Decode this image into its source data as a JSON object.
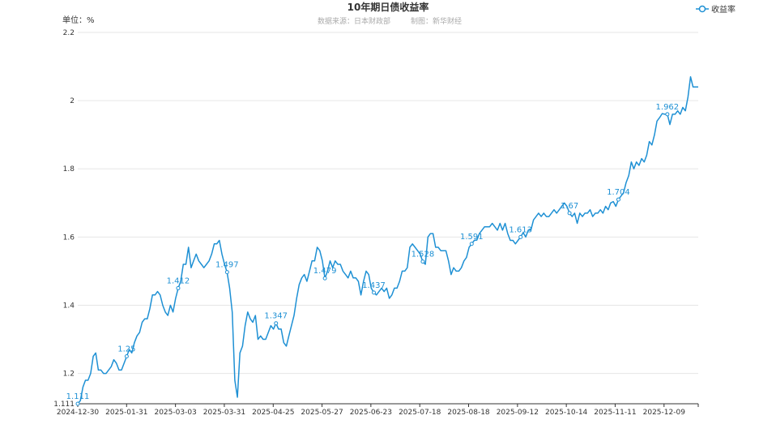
{
  "chart_data": {
    "type": "line",
    "title": "10年期日债收益率",
    "source": "数据来源：日本财政部",
    "maker": "制图：新华财经",
    "unit_label": "单位：%",
    "ylim": [
      1.111,
      2.2
    ],
    "y_ticks": [
      "2.2",
      "2",
      "1.8",
      "1.6",
      "1.4",
      "1.2",
      "1.111"
    ],
    "y_tick_values": [
      2.2,
      2.0,
      1.8,
      1.6,
      1.4,
      1.2,
      1.111
    ],
    "x_ticks": [
      "2024-12-30",
      "2025-01-31",
      "2025-03-03",
      "2025-03-31",
      "2025-04-25",
      "2025-05-27",
      "2025-06-23",
      "2025-07-18",
      "2025-08-18",
      "2025-09-12",
      "2025-10-14",
      "2025-11-11",
      "2025-12-09"
    ],
    "grid": true,
    "legend_position": "top-right",
    "series": [
      {
        "name": "收益率",
        "color": "#1e90d4",
        "values": [
          1.111,
          1.12,
          1.16,
          1.18,
          1.18,
          1.2,
          1.25,
          1.26,
          1.21,
          1.21,
          1.2,
          1.2,
          1.21,
          1.22,
          1.24,
          1.23,
          1.21,
          1.21,
          1.23,
          1.25,
          1.27,
          1.26,
          1.29,
          1.31,
          1.32,
          1.35,
          1.36,
          1.36,
          1.39,
          1.43,
          1.43,
          1.44,
          1.43,
          1.4,
          1.38,
          1.37,
          1.4,
          1.38,
          1.42,
          1.45,
          1.47,
          1.52,
          1.52,
          1.57,
          1.51,
          1.53,
          1.55,
          1.53,
          1.52,
          1.51,
          1.52,
          1.53,
          1.55,
          1.58,
          1.58,
          1.59,
          1.55,
          1.52,
          1.497,
          1.45,
          1.38,
          1.18,
          1.13,
          1.26,
          1.28,
          1.34,
          1.38,
          1.36,
          1.35,
          1.37,
          1.3,
          1.31,
          1.3,
          1.3,
          1.32,
          1.34,
          1.33,
          1.347,
          1.33,
          1.33,
          1.29,
          1.28,
          1.31,
          1.34,
          1.37,
          1.42,
          1.46,
          1.48,
          1.49,
          1.47,
          1.5,
          1.53,
          1.53,
          1.57,
          1.56,
          1.53,
          1.479,
          1.5,
          1.53,
          1.51,
          1.53,
          1.52,
          1.52,
          1.5,
          1.49,
          1.48,
          1.5,
          1.48,
          1.48,
          1.47,
          1.43,
          1.47,
          1.5,
          1.49,
          1.45,
          1.437,
          1.43,
          1.44,
          1.45,
          1.44,
          1.45,
          1.42,
          1.43,
          1.45,
          1.45,
          1.47,
          1.5,
          1.5,
          1.51,
          1.57,
          1.58,
          1.57,
          1.56,
          1.55,
          1.528,
          1.52,
          1.6,
          1.61,
          1.61,
          1.57,
          1.57,
          1.56,
          1.56,
          1.56,
          1.53,
          1.49,
          1.51,
          1.5,
          1.5,
          1.51,
          1.53,
          1.54,
          1.57,
          1.58,
          1.59,
          1.591,
          1.61,
          1.62,
          1.63,
          1.63,
          1.63,
          1.64,
          1.63,
          1.62,
          1.64,
          1.62,
          1.64,
          1.61,
          1.59,
          1.59,
          1.58,
          1.59,
          1.6,
          1.613,
          1.6,
          1.62,
          1.62,
          1.65,
          1.66,
          1.67,
          1.66,
          1.67,
          1.66,
          1.66,
          1.67,
          1.68,
          1.67,
          1.68,
          1.69,
          1.7,
          1.69,
          1.67,
          1.66,
          1.67,
          1.64,
          1.67,
          1.66,
          1.67,
          1.67,
          1.68,
          1.66,
          1.67,
          1.67,
          1.68,
          1.67,
          1.69,
          1.68,
          1.7,
          1.704,
          1.69,
          1.71,
          1.72,
          1.73,
          1.76,
          1.78,
          1.82,
          1.8,
          1.82,
          1.81,
          1.83,
          1.82,
          1.84,
          1.88,
          1.87,
          1.9,
          1.94,
          1.95,
          1.962,
          1.96,
          1.96,
          1.93,
          1.96,
          1.96,
          1.97,
          1.96,
          1.98,
          1.97,
          2.01,
          2.07,
          2.04,
          2.04,
          2.04
        ]
      }
    ],
    "data_labels": [
      {
        "index": 0,
        "text": "1.111"
      },
      {
        "index": 19,
        "text": "1.25"
      },
      {
        "index": 39,
        "text": "1.412"
      },
      {
        "index": 58,
        "text": "1.497"
      },
      {
        "index": 77,
        "text": "1.347"
      },
      {
        "index": 96,
        "text": "1.479"
      },
      {
        "index": 115,
        "text": "1.437"
      },
      {
        "index": 134,
        "text": "1.528"
      },
      {
        "index": 153,
        "text": "1.591"
      },
      {
        "index": 172,
        "text": "1.613"
      },
      {
        "index": 191,
        "text": "1.67"
      },
      {
        "index": 210,
        "text": "1.704"
      },
      {
        "index": 229,
        "text": "1.962"
      }
    ]
  }
}
